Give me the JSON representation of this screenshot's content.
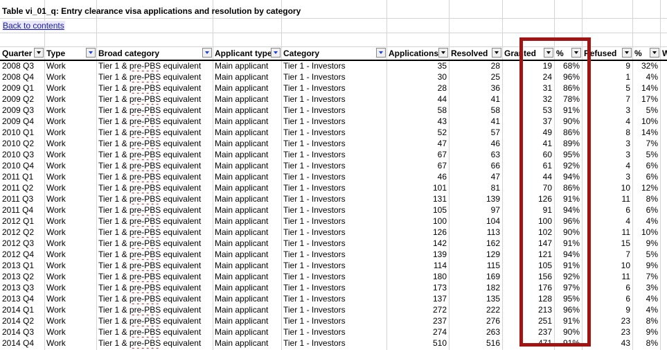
{
  "sheet": {
    "title": "Table vi_01_q: Entry clearance visa applications and resolution by category",
    "back_link": "Back to contents"
  },
  "headers": {
    "quarter": "Quarter",
    "type": "Type",
    "broad": "Broad category",
    "applicant": "Applicant type",
    "category": "Category",
    "applications": "Applications",
    "resolved": "Resolved",
    "granted": "Granted",
    "granted_pct": "%",
    "refused": "Refused",
    "refused_pct": "%",
    "next": "W"
  },
  "rows": [
    {
      "q": "2008 Q3",
      "type": "Work",
      "broad_a": "Tier 1 & ",
      "broad_b": "pre-PBS",
      "broad_c": " equivalent",
      "app": "Main applicant",
      "cat": "Tier 1 - Investors",
      "apps": "35",
      "res": "28",
      "gr": "19",
      "grp": "68%",
      "rf": "9",
      "rfp": "32%"
    },
    {
      "q": "2008 Q4",
      "type": "Work",
      "broad_a": "Tier 1 & ",
      "broad_b": "pre-PBS",
      "broad_c": " equivalent",
      "app": "Main applicant",
      "cat": "Tier 1 - Investors",
      "apps": "30",
      "res": "25",
      "gr": "24",
      "grp": "96%",
      "rf": "1",
      "rfp": "4%"
    },
    {
      "q": "2009 Q1",
      "type": "Work",
      "broad_a": "Tier 1 & ",
      "broad_b": "pre-PBS",
      "broad_c": " equivalent",
      "app": "Main applicant",
      "cat": "Tier 1 - Investors",
      "apps": "28",
      "res": "36",
      "gr": "31",
      "grp": "86%",
      "rf": "5",
      "rfp": "14%"
    },
    {
      "q": "2009 Q2",
      "type": "Work",
      "broad_a": "Tier 1 & ",
      "broad_b": "pre-PBS",
      "broad_c": " equivalent",
      "app": "Main applicant",
      "cat": "Tier 1 - Investors",
      "apps": "44",
      "res": "41",
      "gr": "32",
      "grp": "78%",
      "rf": "7",
      "rfp": "17%"
    },
    {
      "q": "2009 Q3",
      "type": "Work",
      "broad_a": "Tier 1 & ",
      "broad_b": "pre-PBS",
      "broad_c": " equivalent",
      "app": "Main applicant",
      "cat": "Tier 1 - Investors",
      "apps": "58",
      "res": "58",
      "gr": "53",
      "grp": "91%",
      "rf": "3",
      "rfp": "5%"
    },
    {
      "q": "2009 Q4",
      "type": "Work",
      "broad_a": "Tier 1 & ",
      "broad_b": "pre-PBS",
      "broad_c": " equivalent",
      "app": "Main applicant",
      "cat": "Tier 1 - Investors",
      "apps": "43",
      "res": "41",
      "gr": "37",
      "grp": "90%",
      "rf": "4",
      "rfp": "10%"
    },
    {
      "q": "2010 Q1",
      "type": "Work",
      "broad_a": "Tier 1 & ",
      "broad_b": "pre-PBS",
      "broad_c": " equivalent",
      "app": "Main applicant",
      "cat": "Tier 1 - Investors",
      "apps": "52",
      "res": "57",
      "gr": "49",
      "grp": "86%",
      "rf": "8",
      "rfp": "14%"
    },
    {
      "q": "2010 Q2",
      "type": "Work",
      "broad_a": "Tier 1 & ",
      "broad_b": "pre-PBS",
      "broad_c": " equivalent",
      "app": "Main applicant",
      "cat": "Tier 1 - Investors",
      "apps": "47",
      "res": "46",
      "gr": "41",
      "grp": "89%",
      "rf": "3",
      "rfp": "7%"
    },
    {
      "q": "2010 Q3",
      "type": "Work",
      "broad_a": "Tier 1 & ",
      "broad_b": "pre-PBS",
      "broad_c": " equivalent",
      "app": "Main applicant",
      "cat": "Tier 1 - Investors",
      "apps": "67",
      "res": "63",
      "gr": "60",
      "grp": "95%",
      "rf": "3",
      "rfp": "5%"
    },
    {
      "q": "2010 Q4",
      "type": "Work",
      "broad_a": "Tier 1 & ",
      "broad_b": "pre-PBS",
      "broad_c": " equivalent",
      "app": "Main applicant",
      "cat": "Tier 1 - Investors",
      "apps": "67",
      "res": "66",
      "gr": "61",
      "grp": "92%",
      "rf": "4",
      "rfp": "6%"
    },
    {
      "q": "2011 Q1",
      "type": "Work",
      "broad_a": "Tier 1 & ",
      "broad_b": "pre-PBS",
      "broad_c": " equivalent",
      "app": "Main applicant",
      "cat": "Tier 1 - Investors",
      "apps": "46",
      "res": "47",
      "gr": "44",
      "grp": "94%",
      "rf": "3",
      "rfp": "6%"
    },
    {
      "q": "2011 Q2",
      "type": "Work",
      "broad_a": "Tier 1 & ",
      "broad_b": "pre-PBS",
      "broad_c": " equivalent",
      "app": "Main applicant",
      "cat": "Tier 1 - Investors",
      "apps": "101",
      "res": "81",
      "gr": "70",
      "grp": "86%",
      "rf": "10",
      "rfp": "12%"
    },
    {
      "q": "2011 Q3",
      "type": "Work",
      "broad_a": "Tier 1 & ",
      "broad_b": "pre-PBS",
      "broad_c": " equivalent",
      "app": "Main applicant",
      "cat": "Tier 1 - Investors",
      "apps": "131",
      "res": "139",
      "gr": "126",
      "grp": "91%",
      "rf": "11",
      "rfp": "8%"
    },
    {
      "q": "2011 Q4",
      "type": "Work",
      "broad_a": "Tier 1 & ",
      "broad_b": "pre-PBS",
      "broad_c": " equivalent",
      "app": "Main applicant",
      "cat": "Tier 1 - Investors",
      "apps": "105",
      "res": "97",
      "gr": "91",
      "grp": "94%",
      "rf": "6",
      "rfp": "6%"
    },
    {
      "q": "2012 Q1",
      "type": "Work",
      "broad_a": "Tier 1 & ",
      "broad_b": "pre-PBS",
      "broad_c": " equivalent",
      "app": "Main applicant",
      "cat": "Tier 1 - Investors",
      "apps": "100",
      "res": "104",
      "gr": "100",
      "grp": "96%",
      "rf": "4",
      "rfp": "4%"
    },
    {
      "q": "2012 Q2",
      "type": "Work",
      "broad_a": "Tier 1 & ",
      "broad_b": "pre-PBS",
      "broad_c": " equivalent",
      "app": "Main applicant",
      "cat": "Tier 1 - Investors",
      "apps": "126",
      "res": "113",
      "gr": "102",
      "grp": "90%",
      "rf": "11",
      "rfp": "10%"
    },
    {
      "q": "2012 Q3",
      "type": "Work",
      "broad_a": "Tier 1 & ",
      "broad_b": "pre-PBS",
      "broad_c": " equivalent",
      "app": "Main applicant",
      "cat": "Tier 1 - Investors",
      "apps": "142",
      "res": "162",
      "gr": "147",
      "grp": "91%",
      "rf": "15",
      "rfp": "9%"
    },
    {
      "q": "2012 Q4",
      "type": "Work",
      "broad_a": "Tier 1 & ",
      "broad_b": "pre-PBS",
      "broad_c": " equivalent",
      "app": "Main applicant",
      "cat": "Tier 1 - Investors",
      "apps": "139",
      "res": "129",
      "gr": "121",
      "grp": "94%",
      "rf": "7",
      "rfp": "5%"
    },
    {
      "q": "2013 Q1",
      "type": "Work",
      "broad_a": "Tier 1 & ",
      "broad_b": "pre-PBS",
      "broad_c": " equivalent",
      "app": "Main applicant",
      "cat": "Tier 1 - Investors",
      "apps": "114",
      "res": "115",
      "gr": "105",
      "grp": "91%",
      "rf": "10",
      "rfp": "9%"
    },
    {
      "q": "2013 Q2",
      "type": "Work",
      "broad_a": "Tier 1 & ",
      "broad_b": "pre-PBS",
      "broad_c": " equivalent",
      "app": "Main applicant",
      "cat": "Tier 1 - Investors",
      "apps": "180",
      "res": "169",
      "gr": "156",
      "grp": "92%",
      "rf": "11",
      "rfp": "7%"
    },
    {
      "q": "2013 Q3",
      "type": "Work",
      "broad_a": "Tier 1 & ",
      "broad_b": "pre-PBS",
      "broad_c": " equivalent",
      "app": "Main applicant",
      "cat": "Tier 1 - Investors",
      "apps": "173",
      "res": "182",
      "gr": "176",
      "grp": "97%",
      "rf": "6",
      "rfp": "3%"
    },
    {
      "q": "2013 Q4",
      "type": "Work",
      "broad_a": "Tier 1 & ",
      "broad_b": "pre-PBS",
      "broad_c": " equivalent",
      "app": "Main applicant",
      "cat": "Tier 1 - Investors",
      "apps": "137",
      "res": "135",
      "gr": "128",
      "grp": "95%",
      "rf": "6",
      "rfp": "4%"
    },
    {
      "q": "2014 Q1",
      "type": "Work",
      "broad_a": "Tier 1 & ",
      "broad_b": "pre-PBS",
      "broad_c": " equivalent",
      "app": "Main applicant",
      "cat": "Tier 1 - Investors",
      "apps": "272",
      "res": "222",
      "gr": "213",
      "grp": "96%",
      "rf": "9",
      "rfp": "4%"
    },
    {
      "q": "2014 Q2",
      "type": "Work",
      "broad_a": "Tier 1 & ",
      "broad_b": "pre-PBS",
      "broad_c": " equivalent",
      "app": "Main applicant",
      "cat": "Tier 1 - Investors",
      "apps": "237",
      "res": "276",
      "gr": "251",
      "grp": "91%",
      "rf": "23",
      "rfp": "8%"
    },
    {
      "q": "2014 Q3",
      "type": "Work",
      "broad_a": "Tier 1 & ",
      "broad_b": "pre-PBS",
      "broad_c": " equivalent",
      "app": "Main applicant",
      "cat": "Tier 1 - Investors",
      "apps": "274",
      "res": "263",
      "gr": "237",
      "grp": "90%",
      "rf": "23",
      "rfp": "9%"
    },
    {
      "q": "2014 Q4",
      "type": "Work",
      "broad_a": "Tier 1 & ",
      "broad_b": "pre-PBS",
      "broad_c": " equivalent",
      "app": "Main applicant",
      "cat": "Tier 1 - Investors",
      "apps": "510",
      "res": "516",
      "gr": "471",
      "grp": "91%",
      "rf": "43",
      "rfp": "8%"
    }
  ],
  "annotation": {
    "color": "#a11414"
  }
}
